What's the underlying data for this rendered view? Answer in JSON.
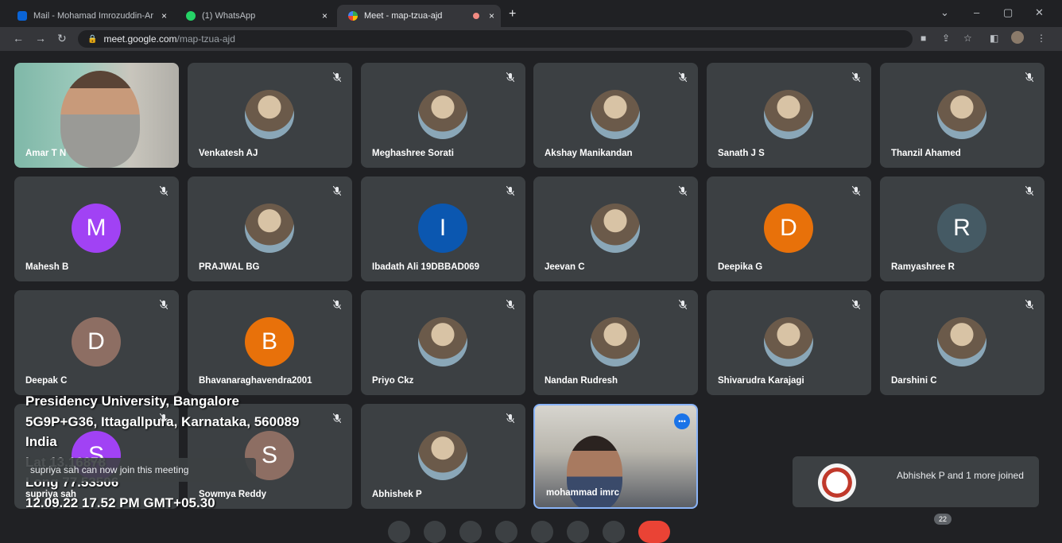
{
  "browser": {
    "tabs": [
      {
        "title": "Mail - Mohamad Imrozuddin-Ar",
        "close": "×",
        "active": false
      },
      {
        "title": "(1) WhatsApp",
        "close": "×",
        "active": false
      },
      {
        "title": "Meet - map-tzua-ajd",
        "close": "×",
        "active": true
      }
    ],
    "new_tab": "+",
    "window_controls": [
      "⌄",
      "–",
      "▢",
      "✕"
    ],
    "url_host": "meet.google.com",
    "url_path": "/map-tzua-ajd"
  },
  "participants": [
    {
      "name": "Amar T N",
      "kind": "video"
    },
    {
      "name": "Venkatesh AJ",
      "kind": "photo"
    },
    {
      "name": "Meghashree Sorati",
      "kind": "photo"
    },
    {
      "name": "Akshay Manikandan",
      "kind": "photo"
    },
    {
      "name": "Sanath J S",
      "kind": "photo"
    },
    {
      "name": "Thanzil Ahamed",
      "kind": "photo"
    },
    {
      "name": "Mahesh B",
      "kind": "letter",
      "letter": "M",
      "color": "#a142f4"
    },
    {
      "name": "PRAJWAL BG",
      "kind": "photo"
    },
    {
      "name": "Ibadath Ali 19DBBAD069",
      "kind": "letter",
      "letter": "I",
      "color": "#0b57b0"
    },
    {
      "name": "Jeevan C",
      "kind": "photo"
    },
    {
      "name": "Deepika G",
      "kind": "letter",
      "letter": "D",
      "color": "#e8710a"
    },
    {
      "name": "Ramyashree R",
      "kind": "letter",
      "letter": "R",
      "color": "#455a64"
    },
    {
      "name": "Deepak C",
      "kind": "letter",
      "letter": "D",
      "color": "#8d6e63"
    },
    {
      "name": "Bhavanaraghavendra2001",
      "kind": "letter",
      "letter": "B",
      "color": "#e8710a"
    },
    {
      "name": "Priyo Ckz",
      "kind": "photo"
    },
    {
      "name": "Nandan Rudresh",
      "kind": "photo"
    },
    {
      "name": "Shivarudra Karajagi",
      "kind": "photo"
    },
    {
      "name": "Darshini C",
      "kind": "photo"
    },
    {
      "name": "supriya sah",
      "kind": "letter",
      "letter": "S",
      "color": "#a142f4"
    },
    {
      "name": "Sowmya Reddy",
      "kind": "letter",
      "letter": "S",
      "color": "#8d6e63"
    },
    {
      "name": "Abhishek P",
      "kind": "photo"
    },
    {
      "name": "mohammad imrc",
      "kind": "video"
    }
  ],
  "geo_overlay": {
    "line1": "Presidency University, Bangalore",
    "line2": "5G9P+G36, Ittagallpura, Karnataka, 560089",
    "line3": "India",
    "line4": "Lat 13.16878",
    "line5": "Long 77.53506",
    "line6": "12.09.22  17.52 PM GMT+05.30"
  },
  "toast": "supriya sah can now join this meeting",
  "joined_notification": "Abhishek P and 1 more joined",
  "participant_count": "22",
  "icons": {
    "mic_off": "mic-off-icon",
    "speaking": "audio-wave-icon"
  }
}
